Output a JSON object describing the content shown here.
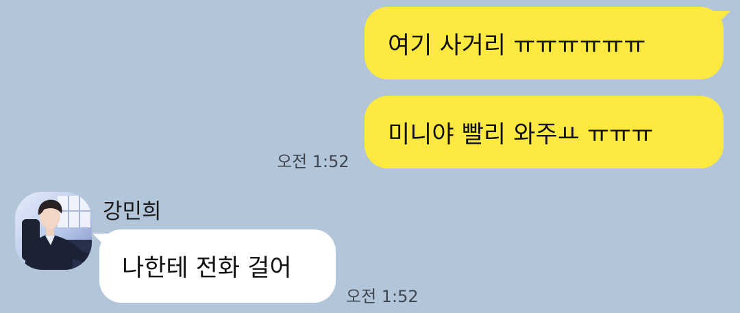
{
  "messages_sent": [
    {
      "text": "여기 사거리 ㅠㅠㅠㅠㅠㅠ"
    },
    {
      "text": "미니야 빨리 와주ㅛ ㅠㅠㅠ"
    }
  ],
  "sent_timestamp": "오전 1:52",
  "received": {
    "sender_name": "강민희",
    "avatar_icon": "profile-photo",
    "text": "나한테 전화 걸어",
    "timestamp": "오전 1:52"
  },
  "colors": {
    "background": "#b3c6d9",
    "sent_bubble": "#fde93f",
    "received_bubble": "#ffffff"
  }
}
